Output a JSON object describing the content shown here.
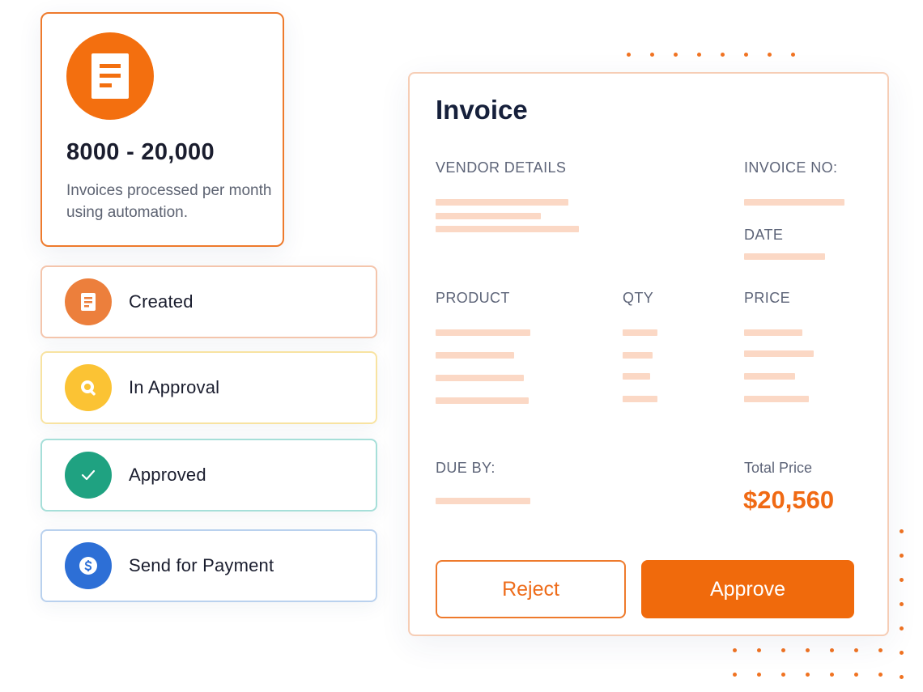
{
  "stat": {
    "icon": "document-icon",
    "value": "8000 - 20,000",
    "description": "Invoices processed per month using automation."
  },
  "statuses": [
    {
      "label": "Created",
      "icon": "document-icon",
      "color": "#ec7f3c",
      "border": "#f4c5ac"
    },
    {
      "label": "In Approval",
      "icon": "search-icon",
      "color": "#fbc334",
      "border": "#f8e3a1"
    },
    {
      "label": "Approved",
      "icon": "check-icon",
      "color": "#1fa281",
      "border": "#a6dfd9"
    },
    {
      "label": "Send for Payment",
      "icon": "dollar-icon",
      "color": "#2d6fd6",
      "border": "#b9d1ee"
    }
  ],
  "invoice": {
    "title": "Invoice",
    "vendor_details_label": "VENDOR DETAILS",
    "invoice_no_label": "INVOICE NO:",
    "date_label": "DATE",
    "product_label": "PRODUCT",
    "qty_label": "QTY",
    "price_label": "PRICE",
    "due_by_label": "DUE BY:",
    "total_price_label": "Total Price",
    "total_price_value": "$20,560",
    "reject_label": "Reject",
    "approve_label": "Approve"
  },
  "colors": {
    "accent": "#f06a0c",
    "placeholder_bar": "#fbd8c5",
    "heading": "#16203b"
  }
}
